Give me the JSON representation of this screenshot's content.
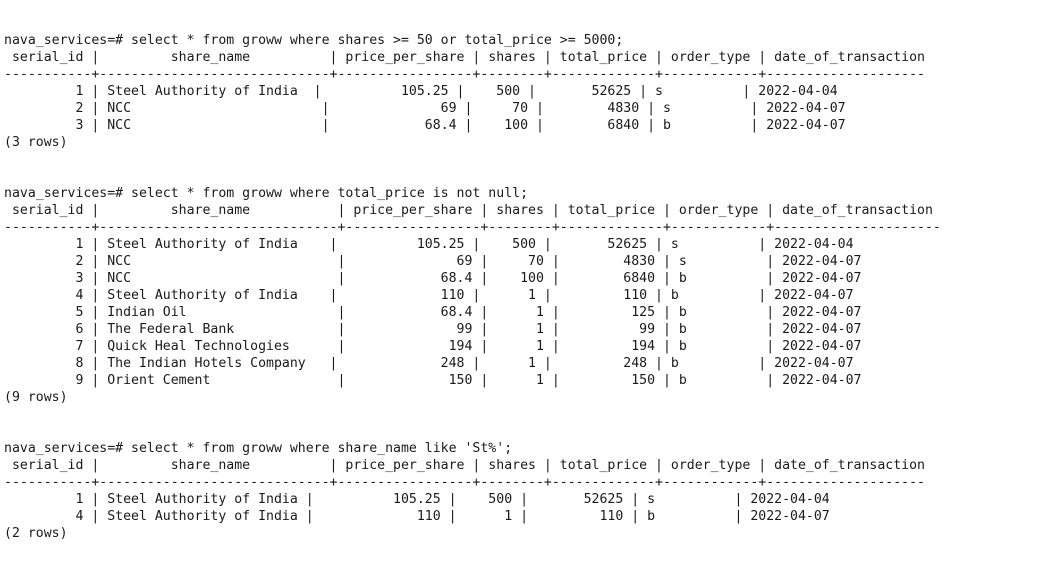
{
  "terminal": {
    "blocks": [
      {
        "command": "nava_services=# select * from groww where shares >= 50 or total_price >= 5000;",
        "header": " serial_id |         share_name          | price_per_share | shares | total_price | order_type | date_of_transaction",
        "separator": "-----------+-----------------------------+-----------------+--------+-------------+------------+--------------------",
        "rows": [
          "         1 | Steel Authority of India  |          105.25 |    500 |       52625 | s          | 2022-04-04",
          "         2 | NCC                        |              69 |     70 |        4830 | s          | 2022-04-07",
          "         3 | NCC                        |            68.4 |    100 |        6840 | b          | 2022-04-07"
        ],
        "footer": "(3 rows)"
      },
      {
        "command": "nava_services=# select * from groww where total_price is not null;",
        "header": " serial_id |         share_name           | price_per_share | shares | total_price | order_type | date_of_transaction",
        "separator": "-----------+------------------------------+-----------------+--------+-------------+------------+---------------------",
        "rows": [
          "         1 | Steel Authority of India    |          105.25 |    500 |       52625 | s          | 2022-04-04",
          "         2 | NCC                          |              69 |     70 |        4830 | s          | 2022-04-07",
          "         3 | NCC                          |            68.4 |    100 |        6840 | b          | 2022-04-07",
          "         4 | Steel Authority of India    |             110 |      1 |         110 | b          | 2022-04-07",
          "         5 | Indian Oil                   |            68.4 |      1 |         125 | b          | 2022-04-07",
          "         6 | The Federal Bank             |              99 |      1 |          99 | b          | 2022-04-07",
          "         7 | Quick Heal Technologies      |             194 |      1 |         194 | b          | 2022-04-07",
          "         8 | The Indian Hotels Company   |             248 |      1 |         248 | b          | 2022-04-07",
          "         9 | Orient Cement                |             150 |      1 |         150 | b          | 2022-04-07"
        ],
        "footer": "(9 rows)"
      },
      {
        "command": "nava_services=# select * from groww where share_name like 'St%';",
        "header": " serial_id |         share_name          | price_per_share | shares | total_price | order_type | date_of_transaction",
        "separator": "-----------+-----------------------------+-----------------+--------+-------------+------------+--------------------",
        "rows": [
          "         1 | Steel Authority of India |          105.25 |    500 |       52625 | s          | 2022-04-04",
          "         4 | Steel Authority of India |             110 |      1 |         110 | b          | 2022-04-07"
        ],
        "footer": "(2 rows)"
      }
    ]
  }
}
